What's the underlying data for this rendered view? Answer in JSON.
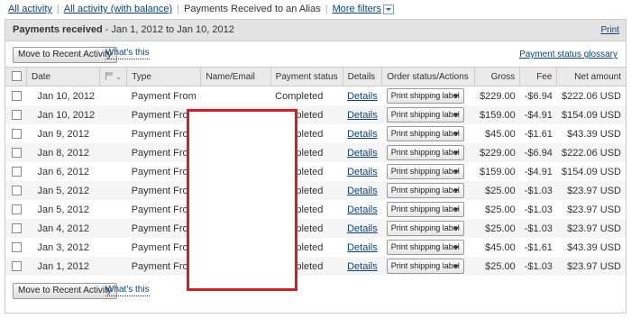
{
  "filters": {
    "all_activity": "All activity",
    "all_activity_balance": "All activity (with balance)",
    "current": "Payments Received to an Alias",
    "more_filters": "More filters"
  },
  "panel": {
    "title_bold": "Payments received",
    "title_range": " - Jan 1, 2012 to Jan 10, 2012",
    "print": "Print",
    "move_button": "Move to Recent Activity",
    "whats_this": "What's this",
    "glossary": "Payment status glossary"
  },
  "columns": {
    "date": "Date",
    "type": "Type",
    "name_email": "Name/Email",
    "payment_status": "Payment status",
    "details": "Details",
    "order_status": "Order status/Actions",
    "gross": "Gross",
    "fee": "Fee",
    "net": "Net amount"
  },
  "rows": [
    {
      "date": "Jan 10, 2012",
      "type": "Payment From",
      "status": "Completed",
      "details": "Details",
      "action": "Print shipping label",
      "gross": "$229.00",
      "fee": "-$6.94",
      "net": "$222.06 USD"
    },
    {
      "date": "Jan 10, 2012",
      "type": "Payment From",
      "status": "Completed",
      "details": "Details",
      "action": "Print shipping label",
      "gross": "$159.00",
      "fee": "-$4.91",
      "net": "$154.09 USD"
    },
    {
      "date": "Jan 9, 2012",
      "type": "Payment From",
      "status": "Completed",
      "details": "Details",
      "action": "Print shipping label",
      "gross": "$45.00",
      "fee": "-$1.61",
      "net": "$43.39 USD"
    },
    {
      "date": "Jan 8, 2012",
      "type": "Payment From",
      "status": "Completed",
      "details": "Details",
      "action": "Print shipping label",
      "gross": "$229.00",
      "fee": "-$6.94",
      "net": "$222.06 USD"
    },
    {
      "date": "Jan 6, 2012",
      "type": "Payment From",
      "status": "Completed",
      "details": "Details",
      "action": "Print shipping label",
      "gross": "$159.00",
      "fee": "-$4.91",
      "net": "$154.09 USD"
    },
    {
      "date": "Jan 5, 2012",
      "type": "Payment From",
      "status": "Completed",
      "details": "Details",
      "action": "Print shipping label",
      "gross": "$25.00",
      "fee": "-$1.03",
      "net": "$23.97 USD"
    },
    {
      "date": "Jan 5, 2012",
      "type": "Payment From",
      "status": "Completed",
      "details": "Details",
      "action": "Print shipping label",
      "gross": "$25.00",
      "fee": "-$1.03",
      "net": "$23.97 USD"
    },
    {
      "date": "Jan 4, 2012",
      "type": "Payment From",
      "status": "Completed",
      "details": "Details",
      "action": "Print shipping label",
      "gross": "$25.00",
      "fee": "-$1.03",
      "net": "$23.97 USD"
    },
    {
      "date": "Jan 3, 2012",
      "type": "Payment From",
      "status": "Completed",
      "details": "Details",
      "action": "Print shipping label",
      "gross": "$45.00",
      "fee": "-$1.61",
      "net": "$43.39 USD"
    },
    {
      "date": "Jan 1, 2012",
      "type": "Payment From",
      "status": "Completed",
      "details": "Details",
      "action": "Print shipping label",
      "gross": "$25.00",
      "fee": "-$1.03",
      "net": "$23.97 USD"
    }
  ],
  "colors": {
    "link": "#084482",
    "redaction_border": "#d81b25",
    "header_bg": "#e3e3e3",
    "alt_row_bg": "#f5f5f5"
  },
  "icons": [
    "flag-icon",
    "checkbox-icon",
    "dropdown-arrow-icon"
  ]
}
